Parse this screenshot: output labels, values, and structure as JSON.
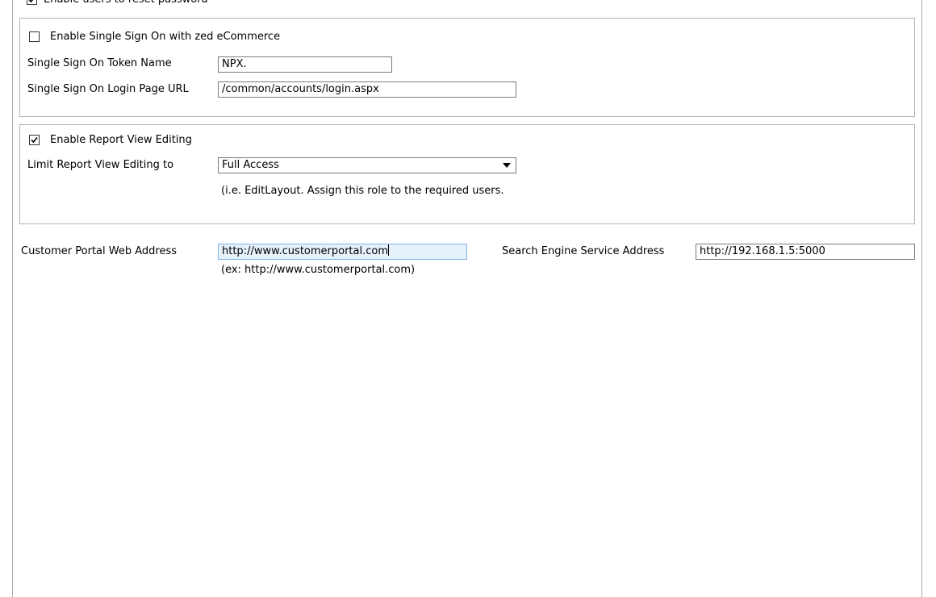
{
  "reset_password": {
    "label": "Enable users to reset password",
    "checked": true
  },
  "sso": {
    "enable_label": "Enable Single Sign On with zed eCommerce",
    "enabled": false,
    "token_name_label": "Single Sign On Token Name",
    "token_name_value": "NPX.",
    "login_url_label": "Single Sign On Login Page URL",
    "login_url_value": "/common/accounts/login.aspx"
  },
  "report_view": {
    "enable_label": "Enable Report View Editing",
    "enabled": true,
    "limit_label": "Limit Report View Editing to",
    "limit_value": "Full Access",
    "hint": "(i.e. EditLayout. Assign this role to the required users."
  },
  "portal": {
    "label": "Customer Portal Web Address",
    "value": "http://www.customerportal.com",
    "example": "(ex: http://www.customerportal.com)"
  },
  "search_engine": {
    "label": "Search Engine Service Address",
    "value": "http://192.168.1.5:5000"
  }
}
